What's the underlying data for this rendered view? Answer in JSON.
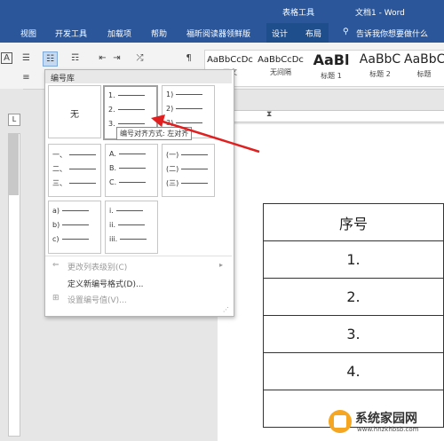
{
  "window": {
    "context_tab_group": "表格工具",
    "doc_title": "文档1 - Word"
  },
  "tabs": [
    "视图",
    "开发工具",
    "加载项",
    "帮助",
    "福昕阅读器领鲜版",
    "设计",
    "布局"
  ],
  "tell_me": "告诉我你想要做什么",
  "styles": [
    {
      "sample": "AaBbCcDc",
      "label": "正文"
    },
    {
      "sample": "AaBbCcDc",
      "label": "无间隔"
    },
    {
      "sample": "AaBl",
      "label": "标题 1"
    },
    {
      "sample": "AaBbC",
      "label": "标题 2"
    },
    {
      "sample": "AaBbC",
      "label": "标题"
    }
  ],
  "numbering": {
    "header": "编号库",
    "none_label": "无",
    "tiles": [
      [
        "1.",
        "2.",
        "3."
      ],
      [
        "1)",
        "2)",
        "3)"
      ],
      [
        "一、",
        "二、",
        "三、"
      ],
      [
        "A.",
        "B.",
        "C."
      ],
      [
        "(一)",
        "(二)",
        "(三)"
      ],
      [
        "a)",
        "b)",
        "c)"
      ],
      [
        "i.",
        "ii.",
        "iii."
      ]
    ],
    "tooltip": "编号对齐方式: 左对齐",
    "menu": {
      "change_level": "更改列表级别(C)",
      "define_new": "定义新编号格式(D)...",
      "set_value": "设置编号值(V)..."
    }
  },
  "table": {
    "header": "序号",
    "rows": [
      "1.",
      "2.",
      "3.",
      "4.",
      ""
    ]
  },
  "watermark": {
    "title": "系统家园网",
    "url": "www.hnzkhbsb.com"
  },
  "colors": {
    "titlebar": "#2b579a",
    "arrow": "#e02020"
  }
}
